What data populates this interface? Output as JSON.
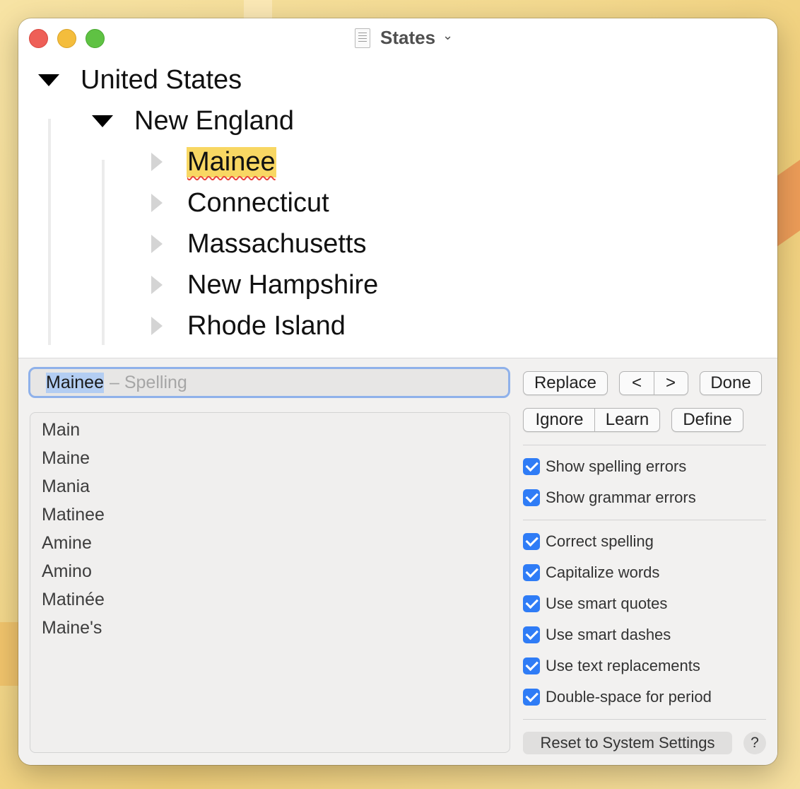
{
  "window": {
    "title": "States",
    "title_chevron": "⌄"
  },
  "outline": {
    "root": "United States",
    "region": "New England",
    "states": [
      "Mainee",
      "Connecticut",
      "Massachusetts",
      "New Hampshire",
      "Rhode Island"
    ],
    "misspelled_highlight_color": "#f8d763"
  },
  "spelling_panel": {
    "word": "Mainee",
    "hint": "– Spelling",
    "suggestions": [
      "Main",
      "Maine",
      "Mania",
      "Matinee",
      "Amine",
      "Amino",
      "Matinée",
      "Maine's"
    ],
    "buttons": {
      "replace": "Replace",
      "prev": "<",
      "next": ">",
      "done": "Done",
      "ignore": "Ignore",
      "learn": "Learn",
      "define": "Define",
      "reset": "Reset to System Settings",
      "help": "?"
    },
    "options_group1": [
      {
        "label": "Show spelling errors",
        "checked": true
      },
      {
        "label": "Show grammar errors",
        "checked": true
      }
    ],
    "options_group2": [
      {
        "label": "Correct spelling",
        "checked": true
      },
      {
        "label": "Capitalize words",
        "checked": true
      },
      {
        "label": "Use smart quotes",
        "checked": true
      },
      {
        "label": "Use smart dashes",
        "checked": true
      },
      {
        "label": "Use text replacements",
        "checked": true
      },
      {
        "label": "Double-space for period",
        "checked": true
      }
    ],
    "accent_color": "#2f7cf6"
  }
}
